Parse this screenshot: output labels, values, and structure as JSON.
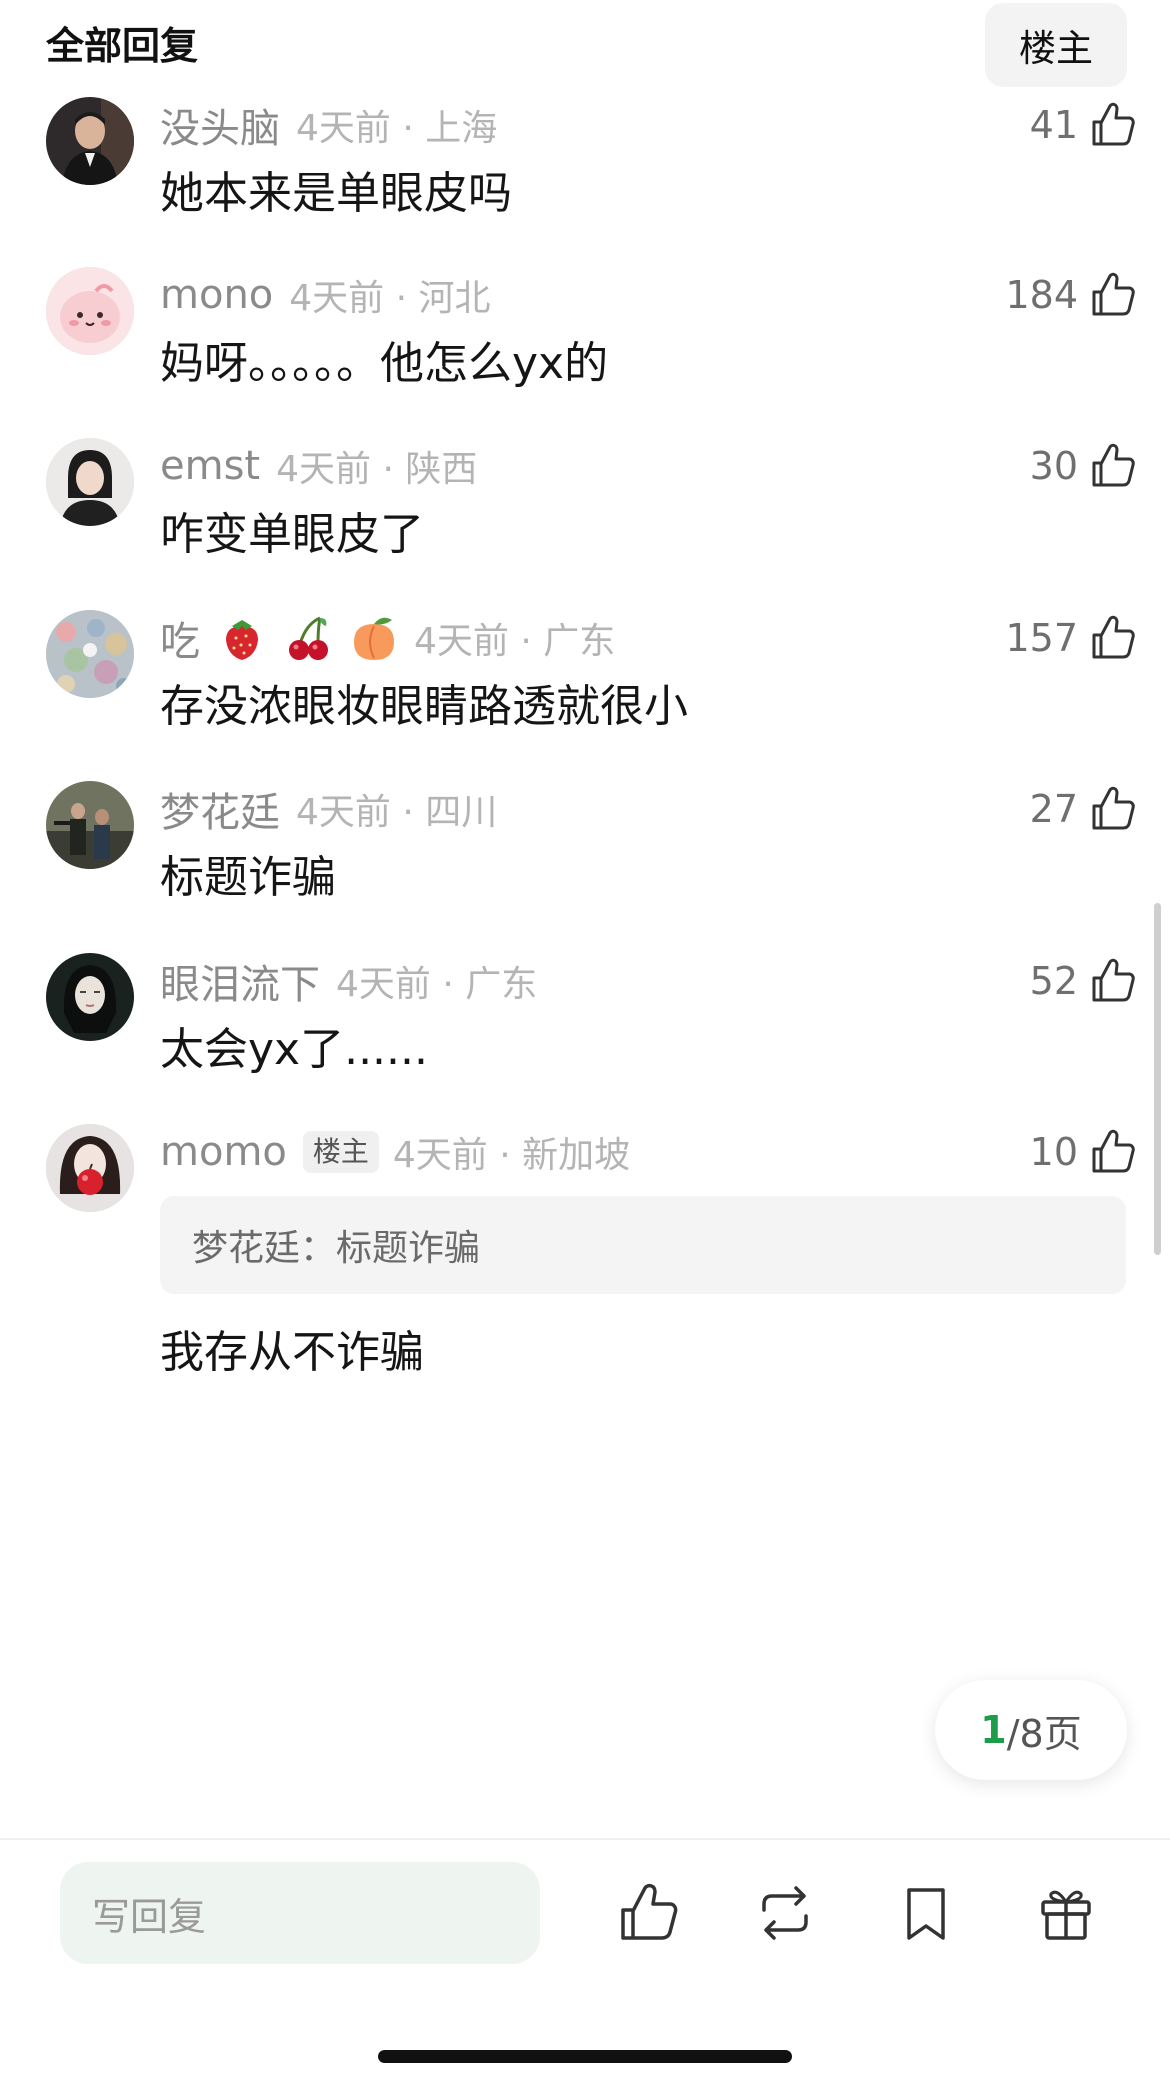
{
  "header": {
    "title": "全部回复",
    "op_filter_label": "楼主"
  },
  "comments": [
    {
      "username": "没头脑",
      "time_location": "4天前 · 上海",
      "likes": "41",
      "content": "她本来是单眼皮吗",
      "avatar": "man-in-suit-avatar"
    },
    {
      "username": "mono",
      "time_location": "4天前 · 河北",
      "likes": "184",
      "content": "妈呀。。。。。他怎么yx的",
      "avatar": "pink-cartoon-avatar"
    },
    {
      "username": "emst",
      "time_location": "4天前 · 陕西",
      "likes": "30",
      "content": "咋变单眼皮了",
      "avatar": "woman-portrait-avatar"
    },
    {
      "username": "吃",
      "username_emojis": [
        "strawberry",
        "cherries",
        "peach"
      ],
      "time_location": "4天前 · 广东",
      "likes": "157",
      "content": "存没浓眼妆眼睛路透就很小",
      "avatar": "colorful-pattern-avatar"
    },
    {
      "username": "梦花廷",
      "time_location": "4天前 · 四川",
      "likes": "27",
      "content": "标题诈骗",
      "avatar": "movie-scene-avatar"
    },
    {
      "username": "眼泪流下",
      "time_location": "4天前 · 广东",
      "likes": "52",
      "content": "太会yx了......",
      "avatar": "dark-portrait-avatar"
    },
    {
      "username": "momo",
      "badge": "楼主",
      "time_location": "4天前 · 新加坡",
      "likes": "10",
      "quote": "梦花廷：标题诈骗",
      "content": "我存从不诈骗",
      "avatar": "apple-portrait-avatar"
    }
  ],
  "pagination": {
    "current": "1",
    "rest": "/8页"
  },
  "bottom_bar": {
    "reply_placeholder": "写回复",
    "icons": [
      "like-icon",
      "repost-icon",
      "bookmark-icon",
      "gift-icon"
    ]
  },
  "colors": {
    "accent_green": "#1f9c4a",
    "meta_gray": "#8a8a8a",
    "input_bg": "#eef4ef"
  }
}
